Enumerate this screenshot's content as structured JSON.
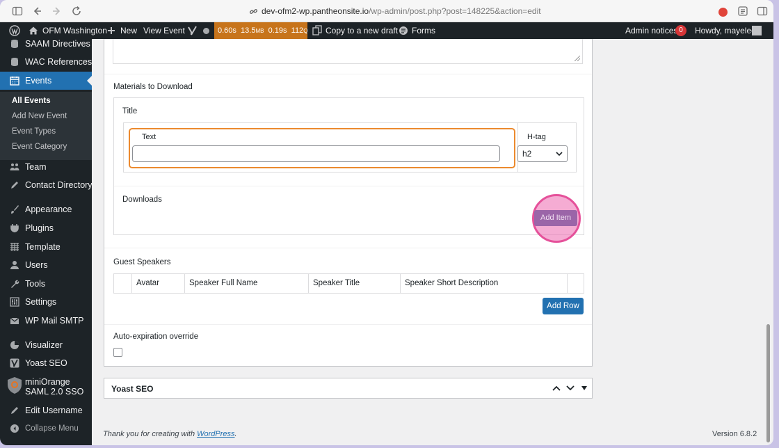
{
  "browser": {
    "url_host": "dev-ofm2-wp.pantheonsite.io",
    "url_path": "/wp-admin/post.php?post=148225&action=edit"
  },
  "adminbar": {
    "site_name": "OFM Washington",
    "new_label": "New",
    "view_event": "View Event",
    "perf": {
      "time1": "0.60s",
      "memory": "13.5",
      "memory_unit": "MB",
      "time2": "0.19s",
      "queries": "112",
      "queries_unit": "Q"
    },
    "copy_draft": "Copy to a new draft",
    "forms": "Forms",
    "admin_notices": "Admin notices",
    "notices_count": "0",
    "howdy": "Howdy, mayelee"
  },
  "sidebar": {
    "items": [
      {
        "label": "SAAM Directives",
        "icon": "database-icon"
      },
      {
        "label": "WAC References",
        "icon": "database-icon"
      },
      {
        "label": "Events",
        "icon": "calendar-icon"
      },
      {
        "label": "Team",
        "icon": "team-icon"
      },
      {
        "label": "Contact Directory",
        "icon": "pen-icon"
      },
      {
        "label": "Appearance",
        "icon": "brush-icon"
      },
      {
        "label": "Plugins",
        "icon": "plugin-icon"
      },
      {
        "label": "Template",
        "icon": "grid-icon"
      },
      {
        "label": "Users",
        "icon": "user-icon"
      },
      {
        "label": "Tools",
        "icon": "wrench-icon"
      },
      {
        "label": "Settings",
        "icon": "settings-icon"
      },
      {
        "label": "WP Mail SMTP",
        "icon": "mail-icon"
      },
      {
        "label": "Visualizer",
        "icon": "chart-icon"
      },
      {
        "label": "Yoast SEO",
        "icon": "yoast-icon"
      },
      {
        "label_line1": "miniOrange",
        "label_line2": "SAML 2.0 SSO",
        "icon": "shield-icon"
      },
      {
        "label": "Edit Username",
        "icon": "pen-icon"
      },
      {
        "label": "Collapse Menu",
        "icon": "collapse-icon"
      }
    ],
    "submenu": [
      "All Events",
      "Add New Event",
      "Event Types",
      "Event Category"
    ]
  },
  "main": {
    "materials_label": "Materials to Download",
    "title_label": "Title",
    "text_label": "Text",
    "text_value": "",
    "htag_label": "H-tag",
    "htag_value": "h2",
    "downloads_label": "Downloads",
    "add_item": "Add Item",
    "guest_speakers_label": "Guest Speakers",
    "speaker_columns": [
      "Avatar",
      "Speaker Full Name",
      "Speaker Title",
      "Speaker Short Description"
    ],
    "add_row": "Add Row",
    "auto_expiration_label": "Auto-expiration override"
  },
  "yoast_panel": {
    "title": "Yoast SEO"
  },
  "footer": {
    "thanks_prefix": "Thank you for creating with ",
    "thanks_link": "WordPress",
    "thanks_suffix": ".",
    "version": "Version 6.8.2"
  },
  "colors": {
    "admin_bar": "#1d2327",
    "accent": "#2271b1",
    "highlight_orange": "#ec8a2e",
    "click_marker": "#e5519a"
  }
}
